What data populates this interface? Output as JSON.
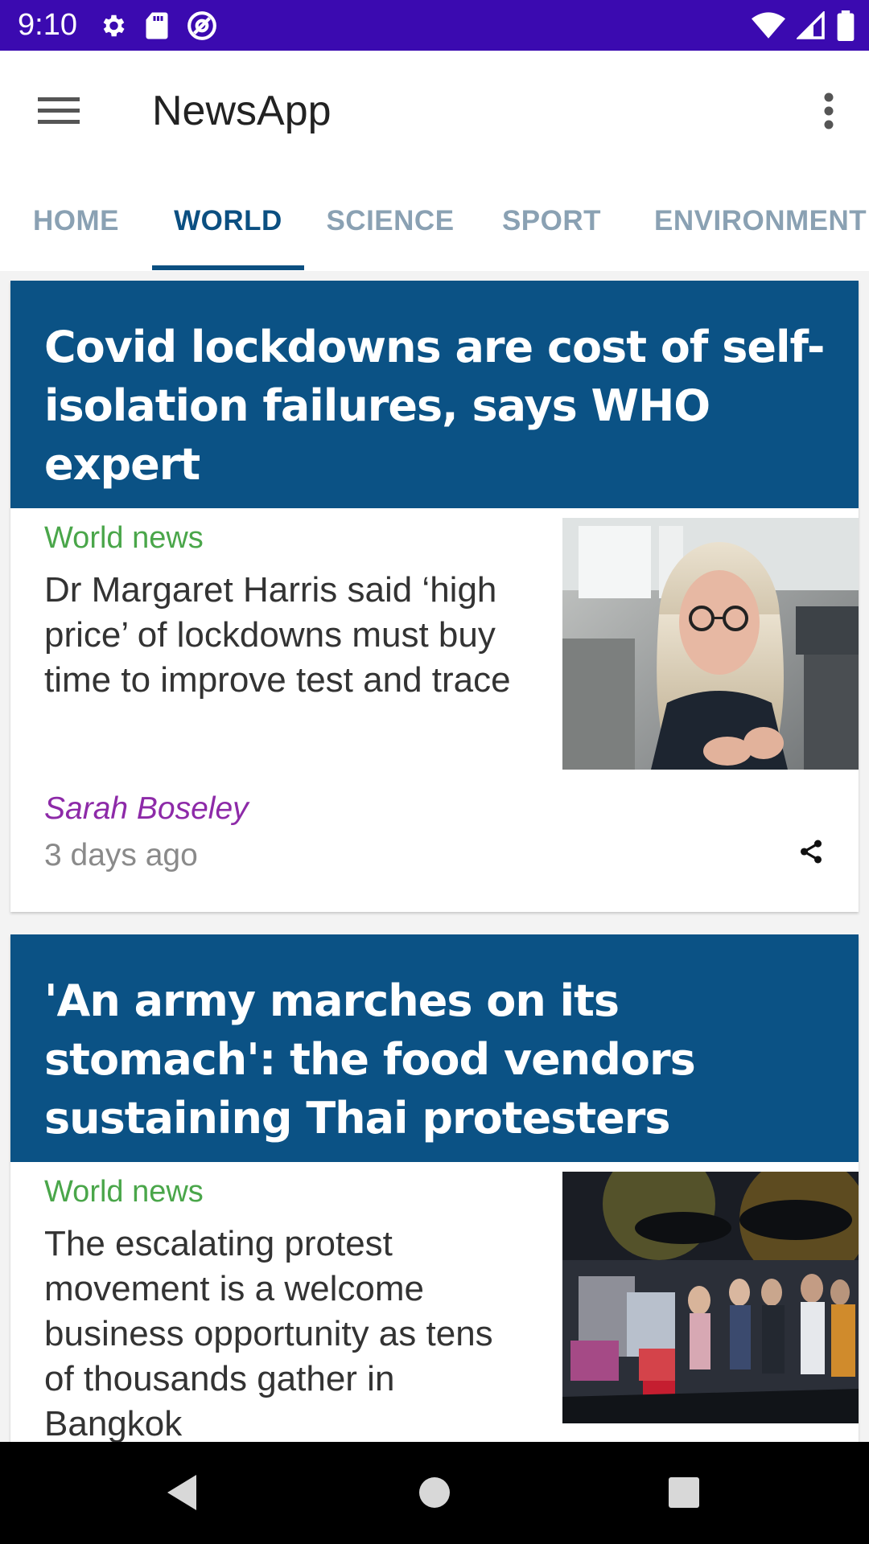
{
  "status_bar": {
    "time": "9:10",
    "left_icons": [
      "gear-icon",
      "sd-card-icon",
      "at-sign-icon"
    ],
    "right_icons": [
      "wifi-icon",
      "cell-signal-icon",
      "battery-icon"
    ],
    "color": "#3b0ab0"
  },
  "app_bar": {
    "title": "NewsApp",
    "menu_icon": "hamburger-menu-icon",
    "overflow_icon": "more-vert-icon"
  },
  "tabs": [
    {
      "label": "HOME",
      "active": false
    },
    {
      "label": "WORLD",
      "active": true
    },
    {
      "label": "SCIENCE",
      "active": false
    },
    {
      "label": "SPORT",
      "active": false
    },
    {
      "label": "ENVIRONMENT",
      "active": false
    }
  ],
  "articles": [
    {
      "headline": "Covid lockdowns are cost of self-isolation failures, says WHO expert",
      "section": "World news",
      "trail": "Dr Margaret Harris said ‘high price’ of lockdowns must buy time to improve test and trace",
      "byline": "Sarah Boseley",
      "age": "3 days ago",
      "share_icon": "share-icon"
    },
    {
      "headline": "'An army marches on its stomach': the food vendors sustaining Thai protesters",
      "section": "World news",
      "trail": "The escalating protest movement is a welcome business opportunity as tens of thousands gather in Bangkok"
    }
  ],
  "colors": {
    "header_blue": "#0b5285",
    "tab_active": "#0b4f81",
    "tab_inactive": "#8aa1b3",
    "section_green": "#4aa64a",
    "byline_purple": "#8d2aa8"
  },
  "nav_bar": {
    "icons": [
      "back-icon",
      "home-icon",
      "recents-icon"
    ]
  }
}
